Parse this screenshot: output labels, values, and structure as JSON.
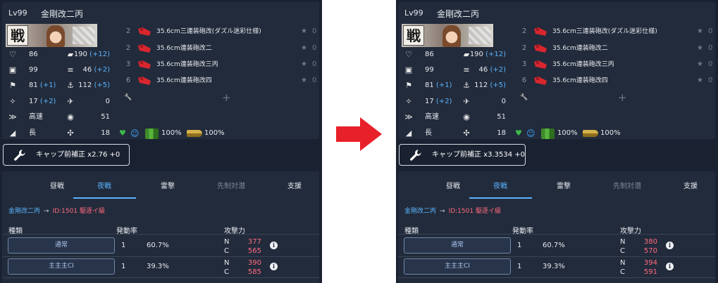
{
  "colors": {
    "panel_bg": "#1a2231",
    "card_bg": "#222b3b",
    "accent_blue": "#5ab3ff",
    "enemy_pink": "#ff6b7f",
    "arrow_red": "#e8202a",
    "equip_red": "#d8262f"
  },
  "panels": [
    {
      "level": "Lv99",
      "ship_name": "金剛改二丙",
      "banner_kanji": "戦",
      "stats_left": [
        {
          "icon": "heart-icon",
          "value": "86",
          "bonus": ""
        },
        {
          "icon": "armor-icon",
          "value": "99",
          "bonus": ""
        },
        {
          "icon": "evasion-icon",
          "value": "81",
          "bonus": " (+1)"
        },
        {
          "icon": "aa-icon",
          "value": "17",
          "bonus": " (+2)"
        },
        {
          "icon": "speed-icon",
          "value": "高速",
          "bonus": ""
        },
        {
          "icon": "range-icon",
          "value": "長",
          "bonus": ""
        }
      ],
      "stats_right": [
        {
          "icon": "firepower-icon",
          "value": "190",
          "bonus": " (+12)"
        },
        {
          "icon": "torpedo-icon",
          "value": "46",
          "bonus": " (+2)"
        },
        {
          "icon": "asw-icon",
          "value": "112",
          "bonus": " (+5)"
        },
        {
          "icon": "plane-icon",
          "value": "0",
          "bonus": ""
        },
        {
          "icon": "los-icon",
          "value": "51",
          "bonus": ""
        },
        {
          "icon": "luck-icon",
          "value": "18",
          "bonus": ""
        }
      ],
      "equipment": [
        {
          "slot": "2",
          "name": "35.6cm三連装砲改(ダズル迷彩仕様)",
          "star": "★",
          "level": "0"
        },
        {
          "slot": "2",
          "name": "35.6cm連装砲改二",
          "star": "★",
          "level": "0"
        },
        {
          "slot": "3",
          "name": "35.6cm連装砲改三丙",
          "star": "★",
          "level": "0"
        },
        {
          "slot": "6",
          "name": "35.6cm連装砲改四",
          "star": "★",
          "level": "0"
        }
      ],
      "ex_slot_plus": "+",
      "fuel": "100%",
      "ammo": "100%",
      "cap_button": "キャップ前補正 x2.76 +0",
      "tabs": [
        "昼戦",
        "夜戦",
        "雷撃",
        "先制対潜",
        "支援"
      ],
      "active_tab": 1,
      "attacker": "金剛改二丙",
      "path_arrow": "→",
      "target": "ID:1501 駆逐イ級",
      "headers": {
        "type": "種類",
        "rate": "発動率",
        "power": "攻撃力"
      },
      "attacks": [
        {
          "name": "通常",
          "count": "1",
          "rate": "60.7%",
          "n_label": "N",
          "n_value": "377",
          "c_label": "C",
          "c_value": "565"
        },
        {
          "name": "主主主CI",
          "count": "1",
          "rate": "39.3%",
          "n_label": "N",
          "n_value": "390",
          "c_label": "C",
          "c_value": "585"
        }
      ]
    },
    {
      "level": "Lv99",
      "ship_name": "金剛改二丙",
      "banner_kanji": "戦",
      "stats_left": [
        {
          "icon": "heart-icon",
          "value": "86",
          "bonus": ""
        },
        {
          "icon": "armor-icon",
          "value": "99",
          "bonus": ""
        },
        {
          "icon": "evasion-icon",
          "value": "81",
          "bonus": " (+1)"
        },
        {
          "icon": "aa-icon",
          "value": "17",
          "bonus": " (+2)"
        },
        {
          "icon": "speed-icon",
          "value": "高速",
          "bonus": ""
        },
        {
          "icon": "range-icon",
          "value": "長",
          "bonus": ""
        }
      ],
      "stats_right": [
        {
          "icon": "firepower-icon",
          "value": "190",
          "bonus": " (+12)"
        },
        {
          "icon": "torpedo-icon",
          "value": "46",
          "bonus": " (+2)"
        },
        {
          "icon": "asw-icon",
          "value": "112",
          "bonus": " (+5)"
        },
        {
          "icon": "plane-icon",
          "value": "0",
          "bonus": ""
        },
        {
          "icon": "los-icon",
          "value": "51",
          "bonus": ""
        },
        {
          "icon": "luck-icon",
          "value": "18",
          "bonus": ""
        }
      ],
      "equipment": [
        {
          "slot": "2",
          "name": "35.6cm三連装砲改(ダズル迷彩仕様)",
          "star": "★",
          "level": "0"
        },
        {
          "slot": "2",
          "name": "35.6cm連装砲改二",
          "star": "★",
          "level": "0"
        },
        {
          "slot": "3",
          "name": "35.6cm連装砲改三丙",
          "star": "★",
          "level": "0"
        },
        {
          "slot": "6",
          "name": "35.6cm連装砲改四",
          "star": "★",
          "level": "0"
        }
      ],
      "ex_slot_plus": "+",
      "fuel": "100%",
      "ammo": "100%",
      "cap_button": "キャップ前補正 x3.3534 +0",
      "tabs": [
        "昼戦",
        "夜戦",
        "雷撃",
        "先制対潜",
        "支援"
      ],
      "active_tab": 1,
      "attacker": "金剛改二丙",
      "path_arrow": "→",
      "target": "ID:1501 駆逐イ級",
      "headers": {
        "type": "種類",
        "rate": "発動率",
        "power": "攻撃力"
      },
      "attacks": [
        {
          "name": "通常",
          "count": "1",
          "rate": "60.7%",
          "n_label": "N",
          "n_value": "380",
          "c_label": "C",
          "c_value": "570"
        },
        {
          "name": "主主主CI",
          "count": "1",
          "rate": "39.3%",
          "n_label": "N",
          "n_value": "394",
          "c_label": "C",
          "c_value": "591"
        }
      ]
    }
  ]
}
